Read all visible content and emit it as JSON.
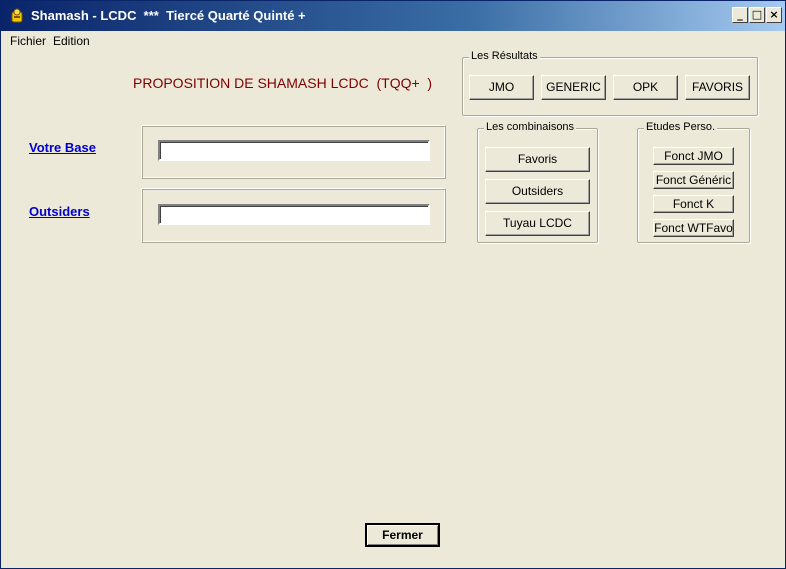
{
  "window": {
    "title": "Shamash - LCDC  ***  Tiercé Quarté Quinté +",
    "min_label": "_",
    "max_label": "□",
    "close_label": "×"
  },
  "menu": {
    "file": "Fichier",
    "edit": "Edition"
  },
  "heading": "PROPOSITION DE SHAMASH LCDC  (TQQ+  )",
  "resultats": {
    "label": "Les Résultats",
    "buttons": [
      "JMO",
      "GENERIC",
      "OPK",
      "FAVORIS"
    ]
  },
  "fields": {
    "base_label": "Votre Base",
    "base_value": "",
    "outsiders_label": "Outsiders",
    "outsiders_value": ""
  },
  "combinaisons": {
    "label": "Les combinaisons",
    "buttons": [
      "Favoris",
      "Outsiders",
      "Tuyau LCDC"
    ]
  },
  "etudes": {
    "label": "Etudes Perso.",
    "buttons": [
      "Fonct JMO",
      "Fonct Généric",
      "Fonct K",
      "Fonct WTFavo"
    ]
  },
  "close_button": "Fermer",
  "colors": {
    "background": "#ece9d8",
    "title_start": "#0a246a",
    "title_end": "#a6caf0",
    "heading": "#800000",
    "link": "#0000cc"
  }
}
